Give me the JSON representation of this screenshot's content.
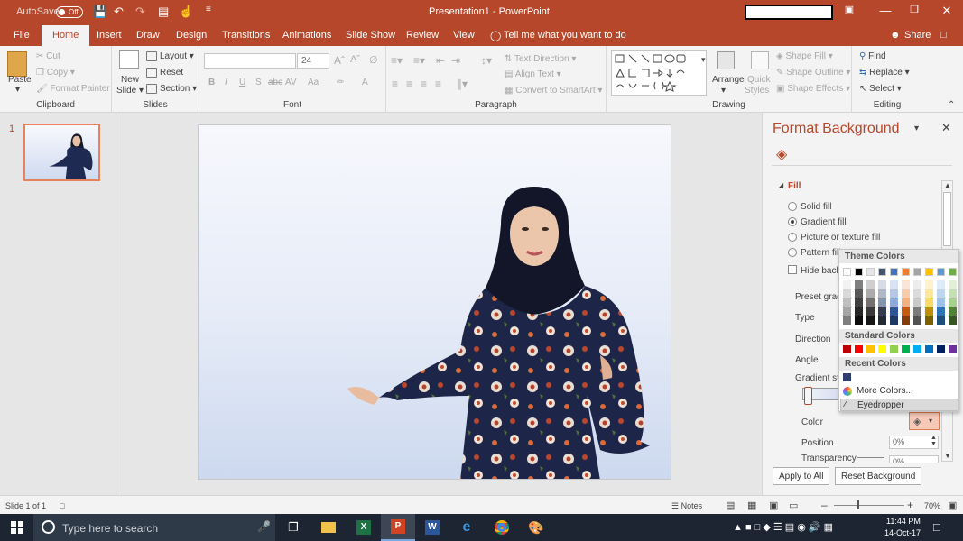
{
  "titlebar": {
    "autosave_label": "AutoSave",
    "autosave_state": "Off",
    "title": "Presentation1 - PowerPoint",
    "icons": [
      "save-icon",
      "undo-icon",
      "redo-icon",
      "present-icon",
      "touch-mode-icon",
      "customize-qat-icon"
    ]
  },
  "tabs": [
    "File",
    "Home",
    "Insert",
    "Draw",
    "Design",
    "Transitions",
    "Animations",
    "Slide Show",
    "Review",
    "View"
  ],
  "active_tab": "Home",
  "tell_me": "Tell me what you want to do",
  "share": "Share",
  "ribbon": {
    "clipboard": {
      "label": "Clipboard",
      "paste": "Paste",
      "cut": "Cut",
      "copy": "Copy",
      "format_painter": "Format Painter"
    },
    "slides": {
      "label": "Slides",
      "new_slide_1": "New",
      "new_slide_2": "Slide",
      "layout": "Layout",
      "reset": "Reset",
      "section": "Section"
    },
    "font": {
      "label": "Font",
      "font_name": "",
      "font_size": "24",
      "bold": "B",
      "italic": "I",
      "underline": "U",
      "strike": "S",
      "shadow": "abc",
      "spacing": "AV",
      "case": "Aa",
      "color": "A"
    },
    "paragraph": {
      "label": "Paragraph",
      "text_direction": "Text Direction",
      "align_text": "Align Text",
      "convert_smartart": "Convert to SmartArt"
    },
    "drawing": {
      "label": "Drawing",
      "arrange": "Arrange",
      "quick_styles_1": "Quick",
      "quick_styles_2": "Styles",
      "shape_fill": "Shape Fill",
      "shape_outline": "Shape Outline",
      "shape_effects": "Shape Effects"
    },
    "editing": {
      "label": "Editing",
      "find": "Find",
      "replace": "Replace",
      "select": "Select"
    }
  },
  "thumbnails": [
    {
      "number": "1"
    }
  ],
  "format_pane": {
    "title": "Format Background",
    "section": "Fill",
    "options": [
      {
        "label": "Solid fill",
        "selected": false
      },
      {
        "label": "Gradient fill",
        "selected": true
      },
      {
        "label": "Picture or texture fill",
        "selected": false
      },
      {
        "label": "Pattern fill",
        "selected": false
      }
    ],
    "hide_background": "Hide backg",
    "preset_gradients": "Preset gradi",
    "type": "Type",
    "direction": "Direction",
    "angle": "Angle",
    "gradient_stops": "Gradient sto",
    "color": "Color",
    "position": "Position",
    "position_value": "0%",
    "transparency": "Transparency",
    "transparency_value": "0%",
    "apply_all": "Apply to All",
    "reset_background": "Reset Background"
  },
  "color_menu": {
    "theme_header": "Theme Colors",
    "standard_header": "Standard Colors",
    "recent_header": "Recent Colors",
    "more_colors": "More Colors...",
    "eyedropper": "Eyedropper",
    "theme_top": [
      "#ffffff",
      "#000000",
      "#e7e6e6",
      "#44546a",
      "#4472c4",
      "#ed7d31",
      "#a5a5a5",
      "#ffc000",
      "#5b9bd5",
      "#70ad47"
    ],
    "theme_shades": [
      [
        "#f2f2f2",
        "#7f7f7f",
        "#d0cece",
        "#d6dce5",
        "#d9e2f3",
        "#fbe5d6",
        "#ededed",
        "#fff2cc",
        "#deebf7",
        "#e2f0d9"
      ],
      [
        "#d9d9d9",
        "#595959",
        "#aeabab",
        "#adb9ca",
        "#b4c7e7",
        "#f8cbad",
        "#dbdbdb",
        "#ffe699",
        "#bdd7ee",
        "#c5e0b4"
      ],
      [
        "#bfbfbf",
        "#404040",
        "#757171",
        "#8497b0",
        "#8faadc",
        "#f4b183",
        "#c9c9c9",
        "#ffd966",
        "#9dc3e6",
        "#a9d18e"
      ],
      [
        "#a6a6a6",
        "#262626",
        "#3b3838",
        "#333f50",
        "#2f5597",
        "#c55a11",
        "#7b7b7b",
        "#bf9000",
        "#2e75b6",
        "#548235"
      ],
      [
        "#7f7f7f",
        "#0d0d0d",
        "#171616",
        "#222a35",
        "#1f3864",
        "#843c0c",
        "#525252",
        "#7f6000",
        "#1f4e79",
        "#385723"
      ]
    ],
    "standard": [
      "#c00000",
      "#ff0000",
      "#ffc000",
      "#ffff00",
      "#92d050",
      "#00b050",
      "#00b0f0",
      "#0070c0",
      "#002060",
      "#7030a0"
    ],
    "recent": [
      "#2f3f6f"
    ]
  },
  "status": {
    "slide_count": "Slide 1 of 1",
    "notes": "Notes",
    "zoom": "70%"
  },
  "taskbar": {
    "search_placeholder": "Type here to search",
    "time": "11:44 PM",
    "date": "14-Oct-17"
  }
}
